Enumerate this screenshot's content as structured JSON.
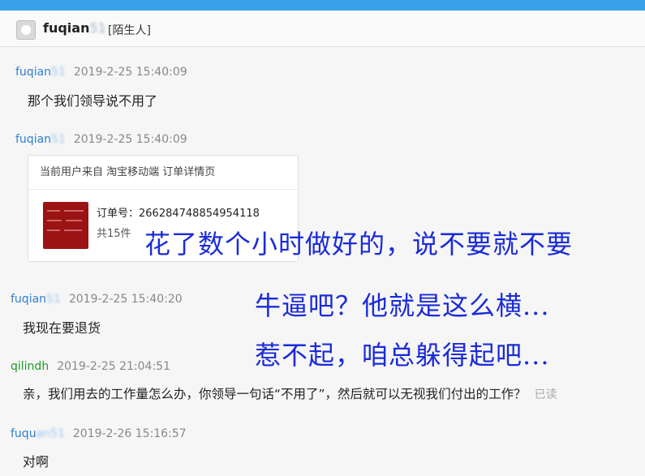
{
  "header": {
    "name_prefix": "fuqian",
    "name_blurred": "51",
    "tag": "[陌生人]"
  },
  "messages": [
    {
      "sender_prefix": "fuqian",
      "sender_blurred": "51",
      "time": "2019-2-25 15:40:09",
      "text": "那个我们领导说不用了"
    },
    {
      "sender_prefix": "fuqian",
      "sender_blurred": "51",
      "time": "2019-2-25 15:40:09"
    },
    {
      "sender_prefix": "fuqian",
      "sender_blurred": "51",
      "time": "2019-2-25 15:40:20",
      "text": "我现在要退货"
    },
    {
      "sender_prefix": "qilindh",
      "time": "2019-2-25 21:04:51",
      "text": "亲，我们用去的工作量怎么办，你领导一句话“不用了”，然后就可以无视我们付出的工作？",
      "status": "已读"
    },
    {
      "sender_prefix": "fuqu",
      "sender_blurred": "an51",
      "time": "2019-2-26 15:16:57",
      "text": "对啊"
    }
  ],
  "order_card": {
    "header": "当前用户来自 淘宝移动端 订单详情页",
    "order_label": "订单号：",
    "order_number": "266284748854954118",
    "count": "共15件"
  },
  "overlay": {
    "line1": "花了数个小时做好的，说不要就不要",
    "line2": "牛逼吧？他就是这么横...",
    "line3": "惹不起，咱总躲得起吧..."
  },
  "colors": {
    "accent_bar": "#3aa0ec",
    "sender_blue": "#2f7fd1",
    "sender_green": "#1f9a2b",
    "overlay_text": "#1b2bd8",
    "thumb_red": "#9b1313"
  }
}
